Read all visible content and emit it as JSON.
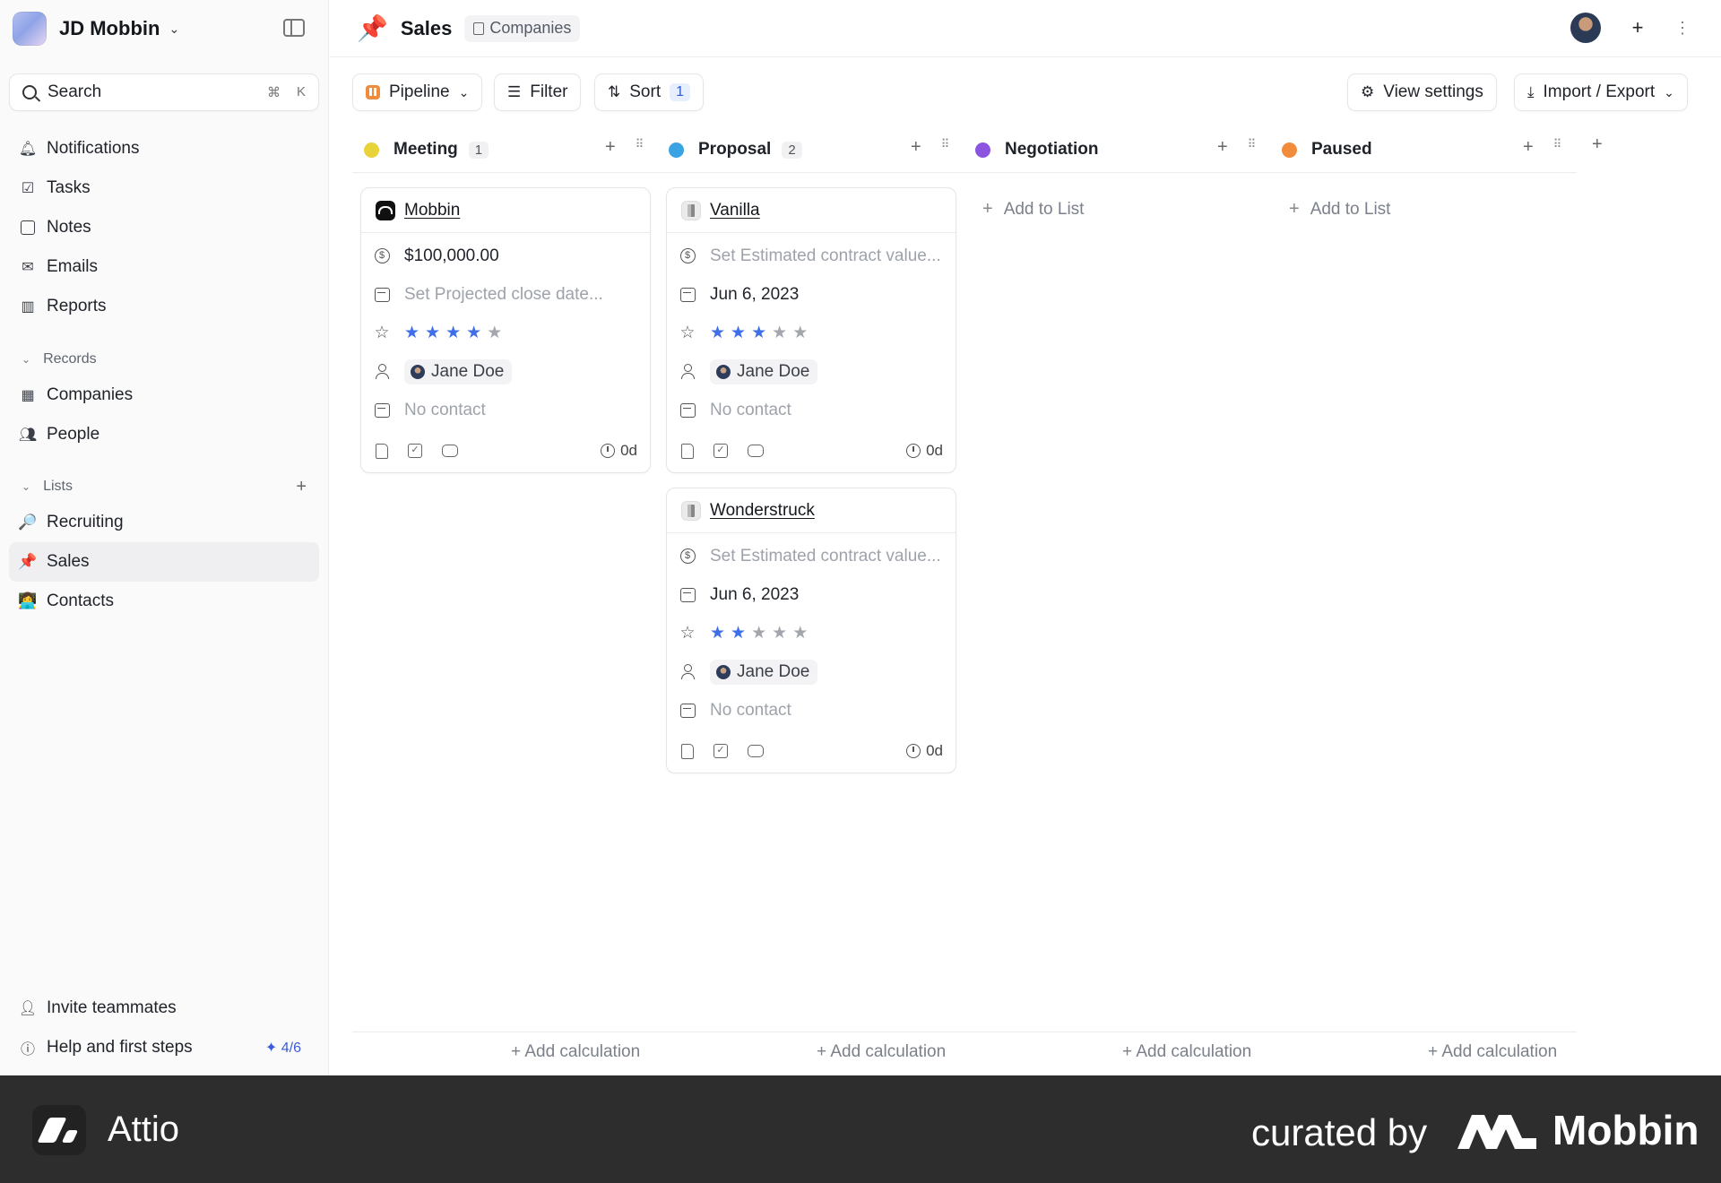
{
  "workspace": {
    "name": "JD Mobbin"
  },
  "search": {
    "label": "Search",
    "shortcut_mod": "⌘",
    "shortcut_key": "K"
  },
  "nav": {
    "notifications": "Notifications",
    "tasks": "Tasks",
    "notes": "Notes",
    "emails": "Emails",
    "reports": "Reports"
  },
  "records": {
    "heading": "Records",
    "companies": "Companies",
    "people": "People"
  },
  "lists": {
    "heading": "Lists",
    "items": [
      {
        "label": "Recruiting",
        "emoji": "🔎"
      },
      {
        "label": "Sales",
        "emoji": "📌"
      },
      {
        "label": "Contacts",
        "emoji": "👩‍💻"
      }
    ]
  },
  "sidebar_bottom": {
    "invite": "Invite teammates",
    "help": "Help and first steps",
    "progress": "4/6"
  },
  "header": {
    "title": "Sales",
    "breadcrumb": "Companies"
  },
  "toolbar": {
    "view": "Pipeline",
    "filter": "Filter",
    "sort": "Sort",
    "sort_count": "1",
    "view_settings": "View settings",
    "import_export": "Import / Export"
  },
  "columns": [
    {
      "name": "Meeting",
      "count": "1",
      "color": "#e8d33a"
    },
    {
      "name": "Proposal",
      "count": "2",
      "color": "#3aa3e3"
    },
    {
      "name": "Negotiation",
      "count": "",
      "color": "#8b55e0"
    },
    {
      "name": "Paused",
      "count": "",
      "color": "#f08c3c"
    }
  ],
  "cards": [
    {
      "company": "Mobbin",
      "value": "$100,000.00",
      "close_date": "Set Projected close date...",
      "rating": 4,
      "owner": "Jane Doe",
      "contact": "No contact",
      "age": "0d"
    },
    {
      "company": "Vanilla",
      "value": "Set Estimated contract value...",
      "close_date": "Jun 6, 2023",
      "rating": 3,
      "owner": "Jane Doe",
      "contact": "No contact",
      "age": "0d"
    },
    {
      "company": "Wonderstruck",
      "value": "Set Estimated contract value...",
      "close_date": "Jun 6, 2023",
      "rating": 2,
      "owner": "Jane Doe",
      "contact": "No contact",
      "age": "0d"
    }
  ],
  "add_to_list": "Add to List",
  "add_calculation": "+ Add calculation",
  "banner": {
    "app": "Attio",
    "curated": "curated by",
    "brand": "Mobbin"
  }
}
